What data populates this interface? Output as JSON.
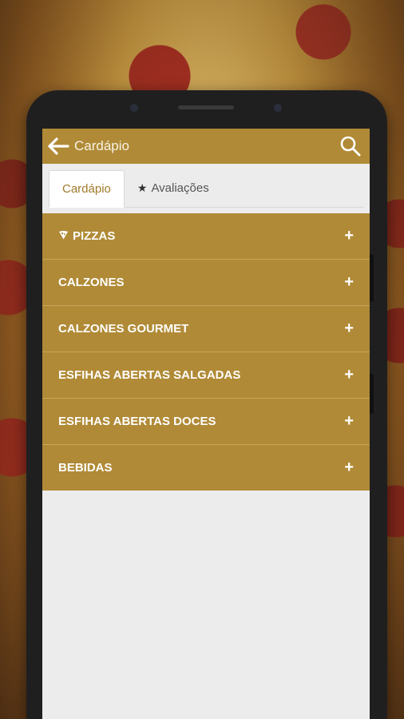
{
  "header": {
    "title": "Cardápio"
  },
  "tabs": [
    {
      "label": "Cardápio",
      "active": true
    },
    {
      "label": "Avaliações",
      "icon": "star-icon",
      "active": false
    }
  ],
  "categories": [
    {
      "label": "PIZZAS",
      "icon": "pizza-slice-icon",
      "action": "+"
    },
    {
      "label": "CALZONES",
      "action": "+"
    },
    {
      "label": "CALZONES GOURMET",
      "action": "+"
    },
    {
      "label": "ESFIHAS ABERTAS SALGADAS",
      "action": "+"
    },
    {
      "label": "ESFIHAS ABERTAS DOCES",
      "action": "+"
    },
    {
      "label": "BEBIDAS",
      "action": "+"
    }
  ],
  "colors": {
    "accent": "#b08a36",
    "active_tab_text": "#a07a2a",
    "background": "#ececec"
  }
}
